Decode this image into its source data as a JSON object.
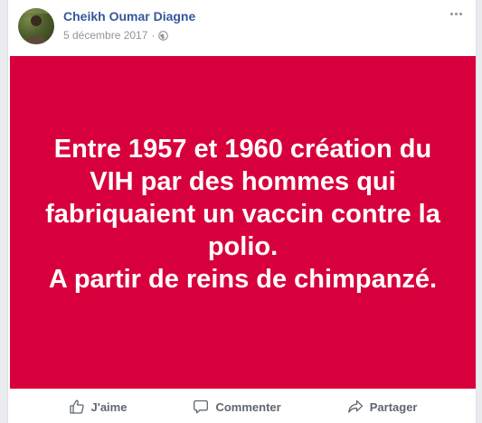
{
  "post": {
    "author": "Cheikh Oumar Diagne",
    "date": "5 décembre 2017",
    "separator": "·",
    "privacy_icon": "globe-icon",
    "status_background": "#d8003c",
    "status_text": "Entre 1957 et 1960 création du\nVIH par des hommes qui\nfabriquaient un vaccin contre la\npolio.\nA partir de reins de chimpanzé."
  },
  "actions": {
    "like": "J'aime",
    "comment": "Commenter",
    "share": "Partager"
  },
  "colors": {
    "author_link": "#365899",
    "meta": "#90949c",
    "action_text": "#606770"
  }
}
